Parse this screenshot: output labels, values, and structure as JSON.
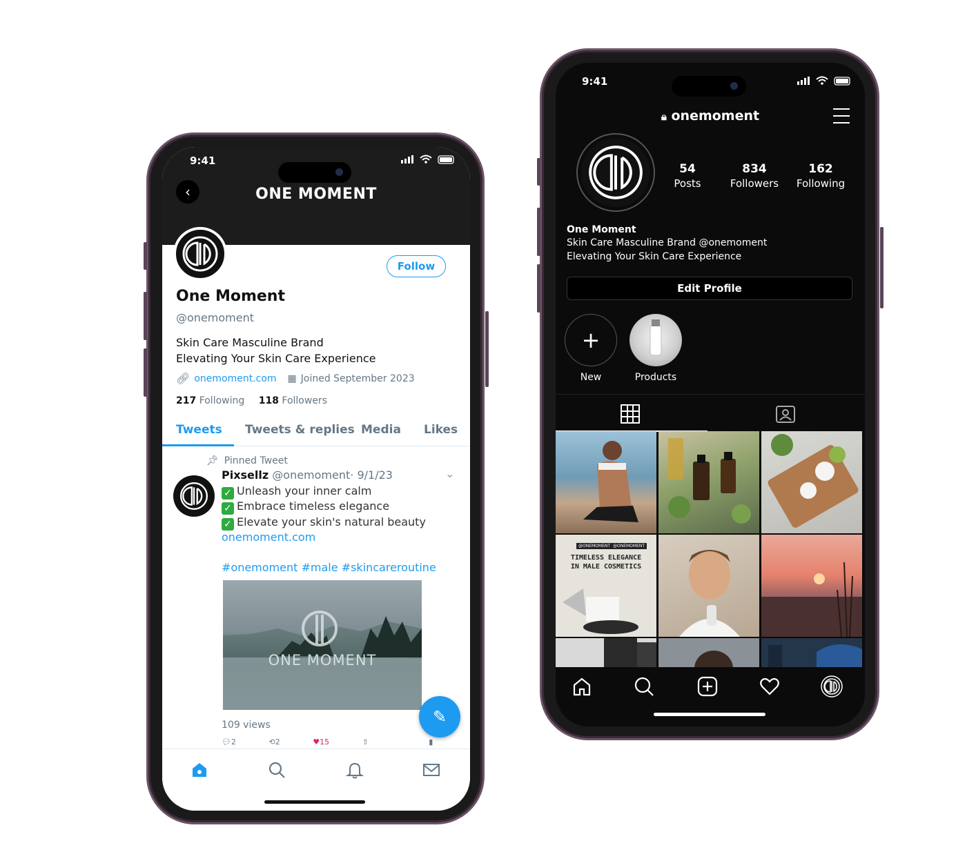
{
  "twitter": {
    "status_time": "9:41",
    "header_title": "ONE MOMENT",
    "follow_label": "Follow",
    "name": "One Moment",
    "handle": "@onemoment",
    "bio_line1": "Skin Care Masculine Brand",
    "bio_line2": "Elevating Your Skin Care Experience",
    "website": "onemoment.com",
    "joined": "Joined September 2023",
    "following_count": "217",
    "following_label": "Following",
    "followers_count": "118",
    "followers_label": "Followers",
    "tabs": [
      "Tweets",
      "Tweets & replies",
      "Media",
      "Likes"
    ],
    "active_tab": "Tweets",
    "tweet": {
      "pinned_label": "Pinned Tweet",
      "author": "Pixsellz",
      "meta": "@onemoment· 9/1/23",
      "lines": [
        "Unleash your inner calm",
        "Embrace timeless elegance",
        "Elevate your skin's natural beauty"
      ],
      "link": "onemoment.com",
      "hashtags": "#onemoment #male #skincareroutine",
      "media_text": "ONE MOMENT",
      "views": "109 views",
      "reply_count": "2",
      "retweet_count": "2",
      "like_count": "15"
    },
    "accent_color": "#1d9bf0"
  },
  "instagram": {
    "status_time": "9:41",
    "username": "onemoment",
    "posts_count": "54",
    "posts_label": "Posts",
    "followers_count": "834",
    "followers_label": "Followers",
    "following_count": "162",
    "following_label": "Following",
    "display_name": "One Moment",
    "bio_line1": "Skin Care Masculine Brand  @onemoment",
    "bio_line2": "Elevating Your Skin Care Experience",
    "edit_profile_label": "Edit Profile",
    "highlights": [
      {
        "label": "New"
      },
      {
        "label": "Products"
      }
    ],
    "grid_post_text": {
      "badge_left": "@ONEMOMENT",
      "badge_right": "@ONEMOMENT",
      "headline_line1": "TIMELESS ELEGANCE",
      "headline_line2": "IN MALE COSMETICS"
    }
  }
}
